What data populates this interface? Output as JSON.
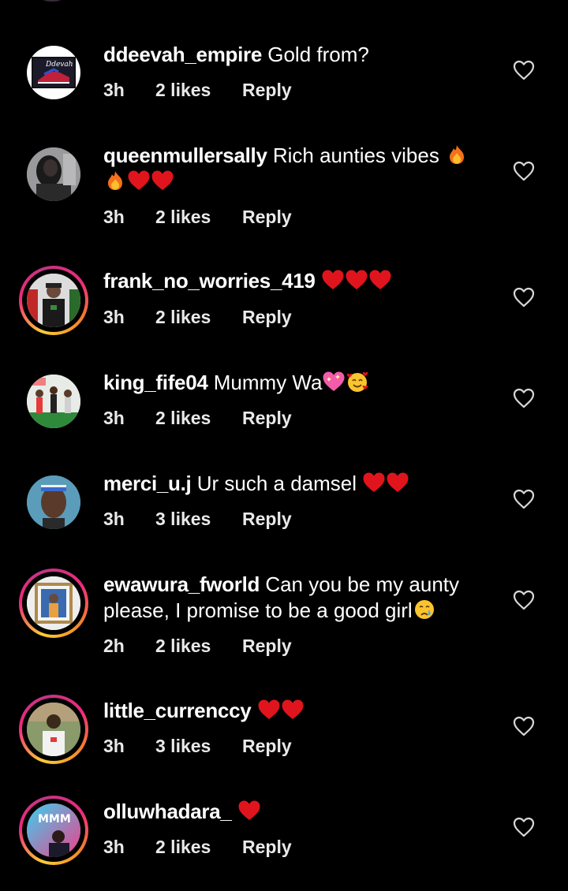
{
  "comments": [
    {
      "username": "ddeevah_empire",
      "text": "Gold from?",
      "time": "3h",
      "likes": "2 likes",
      "reply": "Reply",
      "avatar_icon": "logo-avatar",
      "story_ring": false
    },
    {
      "username": "queenmullersally",
      "text": "Rich aunties vibes 🔥 🔥❤️❤️",
      "time": "3h",
      "likes": "2 likes",
      "reply": "Reply",
      "avatar_icon": "person-avatar",
      "story_ring": false
    },
    {
      "username": "frank_no_worries_419",
      "text": "❤️❤️❤️",
      "time": "3h",
      "likes": "2 likes",
      "reply": "Reply",
      "avatar_icon": "person-avatar",
      "story_ring": true
    },
    {
      "username": "king_fife04",
      "text": "Mummy Wa💖🥰",
      "time": "3h",
      "likes": "2 likes",
      "reply": "Reply",
      "avatar_icon": "person-avatar",
      "story_ring": false
    },
    {
      "username": "merci_u.j",
      "text": "Ur such a damsel ❤️❤️",
      "time": "3h",
      "likes": "3 likes",
      "reply": "Reply",
      "avatar_icon": "person-avatar",
      "story_ring": false
    },
    {
      "username": "ewawura_fworld",
      "text": "Can you be my aunty please, I promise to be a good girl😢",
      "time": "2h",
      "likes": "2 likes",
      "reply": "Reply",
      "avatar_icon": "person-avatar",
      "story_ring": true
    },
    {
      "username": "little_currenccy",
      "text": "❤️❤️",
      "time": "3h",
      "likes": "3 likes",
      "reply": "Reply",
      "avatar_icon": "person-avatar",
      "story_ring": true
    },
    {
      "username": "olluwhadara_",
      "text": "❤️",
      "time": "3h",
      "likes": "2 likes",
      "reply": "Reply",
      "avatar_icon": "person-avatar",
      "story_ring": true
    }
  ],
  "colors": {
    "background": "#000000",
    "text": "#ffffff",
    "meta": "#e9e9e9",
    "heart_outline": "#d8d8d8",
    "red_heart": "#e0141c"
  },
  "icons": {
    "like": "heart-outline-icon",
    "red_heart": "red-heart-emoji",
    "fire": "fire-emoji",
    "sparkling_heart": "sparkling-heart-emoji",
    "smiling_hearts": "smiling-face-with-hearts-emoji",
    "crying": "crying-face-emoji"
  }
}
